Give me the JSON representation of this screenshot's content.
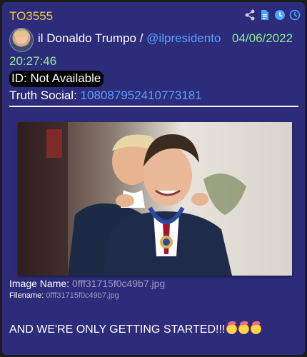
{
  "post": {
    "id": "TO3555",
    "author_name": "il Donaldo Trumpo",
    "separator": "/",
    "handle": "@ilpresidento",
    "date": "04/06/2022",
    "time": "20:27:46",
    "id_line": "ID: Not Available",
    "truth_label": "Truth Social:",
    "truth_id": "108087952410773181",
    "image_name_label": "Image Name:",
    "image_name": "0fff31715f0c49b7.jpg",
    "filename_label": "Filename:",
    "filename": "0fff31715f0c49b7.jpg",
    "message": "AND WE'RE ONLY GETTING STARTED!!!"
  },
  "icons": {
    "share": "share-icon",
    "document": "document-icon",
    "clock_a": "clock-icon",
    "clock_b": "clock-icon",
    "emoji": "partying-face-emoji"
  },
  "colors": {
    "card_bg": "#2c2c7a",
    "id_text": "#f2c94c",
    "timestamp": "#8fef8f",
    "link": "#5aa0ff",
    "muted": "#9b9bc4"
  }
}
